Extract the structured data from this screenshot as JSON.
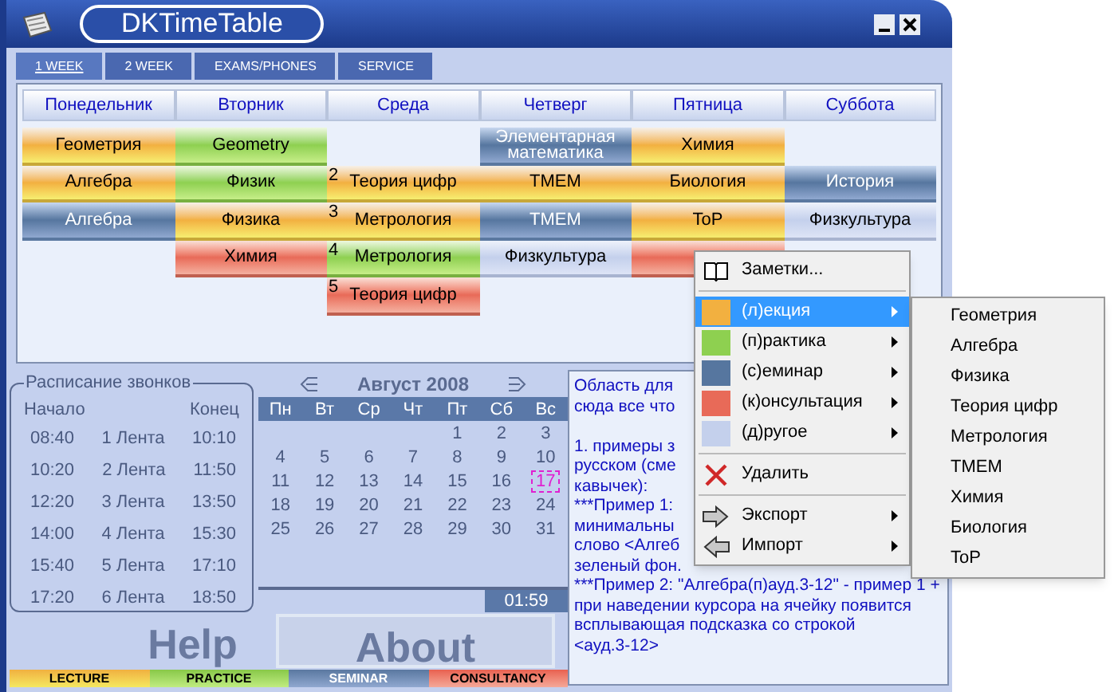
{
  "window": {
    "title": "DKTimeTable"
  },
  "tabs": [
    {
      "label": "1 WEEK",
      "selected": true
    },
    {
      "label": "2 WEEK",
      "selected": false
    },
    {
      "label": "EXAMS/PHONES",
      "selected": false
    },
    {
      "label": "SERVICE",
      "selected": false
    }
  ],
  "timetable": {
    "days": [
      {
        "name": "Понедельник",
        "lessons": [
          {
            "kind": "lecture",
            "subject": "Геометрия"
          },
          {
            "kind": "lecture",
            "subject": "Алгебра"
          },
          {
            "kind": "seminar",
            "subject": "Алгебра"
          },
          {
            "kind": "empty"
          },
          {
            "kind": "empty"
          }
        ]
      },
      {
        "name": "Вторник",
        "lessons": [
          {
            "kind": "practice",
            "subject": "Geometry"
          },
          {
            "kind": "practice",
            "subject": "Физик"
          },
          {
            "kind": "lecture",
            "subject": "Физика"
          },
          {
            "kind": "consultancy",
            "subject": "Химия"
          },
          {
            "kind": "empty"
          }
        ]
      },
      {
        "name": "Среда",
        "lessons": [
          {
            "kind": "empty"
          },
          {
            "kind": "lecture",
            "number": "2",
            "subject": "Теория цифр"
          },
          {
            "kind": "lecture",
            "number": "3",
            "subject": "Метрология"
          },
          {
            "kind": "practice",
            "number": "4",
            "subject": "Метрология"
          },
          {
            "kind": "consultancy",
            "number": "5",
            "subject": "Теория цифр"
          }
        ]
      },
      {
        "name": "Четверг",
        "lessons": [
          {
            "kind": "seminar",
            "subject": "Элементарная математика"
          },
          {
            "kind": "lecture",
            "subject": "ТМЕМ"
          },
          {
            "kind": "seminar",
            "subject": "ТМЕМ"
          },
          {
            "kind": "other",
            "subject": "Физкультура"
          },
          {
            "kind": "empty"
          }
        ]
      },
      {
        "name": "Пятница",
        "lessons": [
          {
            "kind": "lecture",
            "subject": "Химия"
          },
          {
            "kind": "lecture",
            "subject": "Биология"
          },
          {
            "kind": "lecture",
            "subject": "ToP"
          },
          {
            "kind": "consultancy"
          },
          {
            "kind": "empty"
          }
        ]
      },
      {
        "name": "Суббота",
        "lessons": [
          {
            "kind": "empty"
          },
          {
            "kind": "seminar",
            "subject": "История"
          },
          {
            "kind": "other",
            "subject": "Физкультура"
          },
          {
            "kind": "empty"
          },
          {
            "kind": "empty"
          }
        ]
      }
    ]
  },
  "bell_schedule": {
    "title": "Расписание звонков",
    "start_header": "Начало",
    "end_header": "Конец",
    "rows": [
      {
        "start": "08:40",
        "lesson": "1 Лента",
        "end": "10:10"
      },
      {
        "start": "10:20",
        "lesson": "2 Лента",
        "end": "11:50"
      },
      {
        "start": "12:20",
        "lesson": "3 Лента",
        "end": "13:50"
      },
      {
        "start": "14:00",
        "lesson": "4 Лента",
        "end": "15:30"
      },
      {
        "start": "15:40",
        "lesson": "5 Лента",
        "end": "17:10"
      },
      {
        "start": "17:20",
        "lesson": "6 Лента",
        "end": "18:50"
      }
    ]
  },
  "calendar": {
    "month": "Август 2008",
    "weekdays": [
      "Пн",
      "Вт",
      "Ср",
      "Чт",
      "Пт",
      "Сб",
      "Вс"
    ],
    "weeks": [
      [
        {
          "day": "1",
          "selected": false
        },
        {
          "day": "2",
          "selected": false
        },
        {
          "day": "3",
          "selected": false
        }
      ],
      [
        {
          "day": "4",
          "selected": false
        },
        {
          "day": "5",
          "selected": false
        },
        {
          "day": "6",
          "selected": false
        },
        {
          "day": "7",
          "selected": false
        },
        {
          "day": "8",
          "selected": false
        },
        {
          "day": "9",
          "selected": false
        },
        {
          "day": "10",
          "selected": false
        }
      ],
      [
        {
          "day": "11",
          "selected": false
        },
        {
          "day": "12",
          "selected": false
        },
        {
          "day": "13",
          "selected": false
        },
        {
          "day": "14",
          "selected": false
        },
        {
          "day": "15",
          "selected": false
        },
        {
          "day": "16",
          "selected": false
        },
        {
          "day": "17",
          "selected": true
        }
      ],
      [
        {
          "day": "18",
          "selected": false
        },
        {
          "day": "19",
          "selected": false
        },
        {
          "day": "20",
          "selected": false
        },
        {
          "day": "21",
          "selected": false
        },
        {
          "day": "22",
          "selected": false
        },
        {
          "day": "23",
          "selected": false
        },
        {
          "day": "24",
          "selected": false
        }
      ],
      [
        {
          "day": "25",
          "selected": false
        },
        {
          "day": "26",
          "selected": false
        },
        {
          "day": "27",
          "selected": false
        },
        {
          "day": "28",
          "selected": false
        },
        {
          "day": "29",
          "selected": false
        },
        {
          "day": "30",
          "selected": false
        },
        {
          "day": "31",
          "selected": false
        }
      ]
    ],
    "time": "01:59"
  },
  "buttons": [
    "Help",
    "About"
  ],
  "legend": [
    {
      "kind": "lecture",
      "label": "LECTURE"
    },
    {
      "kind": "practice",
      "label": "PRACTICE"
    },
    {
      "kind": "seminar",
      "label": "SEMINAR"
    },
    {
      "kind": "consultancy",
      "label": "CONSULTANCY"
    }
  ],
  "notes": {
    "paragraphs": [
      [
        "Область для",
        "сюда все что"
      ],
      [
        "1. примеры з",
        "русском (сме",
        "кавычек):",
        "***Пример 1:",
        "минимальны",
        "слово <Алгеб",
        "зеленый фон.",
        "***Пример 2: \"Алгебра(п)ауд.3-12\" - пример 1 +",
        "при наведении курсора на ячейку появится",
        "всплывающая подсказка со строкой",
        "<ауд.3-12>"
      ]
    ]
  },
  "context_menu": {
    "items": [
      {
        "kind": "notes",
        "label": "Заметки...",
        "submenu": false,
        "selected": false
      },
      {
        "kind": "separator"
      },
      {
        "kind": "lesson_type",
        "color": "#f2b040",
        "label": "(л)екция",
        "submenu": true,
        "selected": true
      },
      {
        "kind": "lesson_type",
        "color": "#8ed050",
        "label": "(п)рактика",
        "submenu": true,
        "selected": false
      },
      {
        "kind": "lesson_type",
        "color": "#56769f",
        "label": "(с)еминар",
        "submenu": true,
        "selected": false
      },
      {
        "kind": "lesson_type",
        "color": "#e86a58",
        "label": "(к)онсультация",
        "submenu": true,
        "selected": false
      },
      {
        "kind": "lesson_type",
        "color": "#c4d0ec",
        "label": "(д)ругое",
        "submenu": true,
        "selected": false
      },
      {
        "kind": "separator"
      },
      {
        "kind": "delete",
        "label": "Удалить",
        "submenu": false,
        "selected": false
      },
      {
        "kind": "separator"
      },
      {
        "kind": "export",
        "label": "Экспорт",
        "submenu": true,
        "selected": false
      },
      {
        "kind": "import",
        "label": "Импорт",
        "submenu": true,
        "selected": false
      }
    ],
    "submenu": [
      "Геометрия",
      "Алгебра",
      "Физика",
      "Теория цифр",
      "Метрология",
      "ТМЕМ",
      "Химия",
      "Биология",
      "ToP"
    ]
  }
}
